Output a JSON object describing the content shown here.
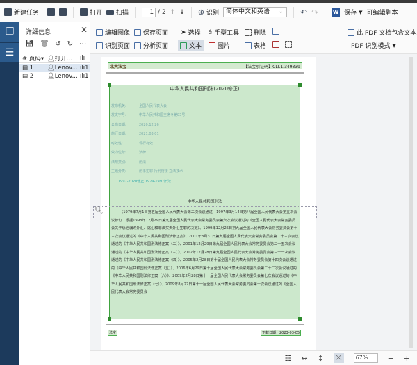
{
  "toolbar": {
    "new_task": "新建任务",
    "open": "打开",
    "scan": "扫描",
    "page_current": "1",
    "page_total": "/ 2",
    "recognize": "识别",
    "language": "简体中文和英语",
    "save": "保存",
    "editable_copy": "可编辑副本"
  },
  "nav": {
    "items": [
      "pages-icon",
      "list-icon"
    ]
  },
  "panel": {
    "title": "详细信息",
    "columns": [
      "#",
      "页码",
      "打开...",
      "ılı"
    ],
    "rows": [
      {
        "page": "1",
        "user": "Lenov...",
        "count": "1"
      },
      {
        "page": "2",
        "user": "Lenov...",
        "count": "1"
      }
    ]
  },
  "ribbon": {
    "edit_image": "编辑图像",
    "save_page": "保存页面",
    "recognize_page": "识别页面",
    "analyze_page": "分析页面",
    "select": "选择",
    "hand_tool": "手型工具",
    "delete": "删除",
    "text": "文本",
    "picture": "图片",
    "table": "表格",
    "text_layer": "此 PDF 文档包含文本层",
    "pdf_mode": "PDF 识别模式"
  },
  "document": {
    "header_logo": "北大法宝",
    "header_ref": "【法宝引证码】CLI.1.349339",
    "title": "中华人民共和国刑法(2020修正)",
    "meta": [
      [
        "发布机关:",
        "全国人民代表大会"
      ],
      [
        "发文字号:",
        "中华人民共和国主席令第83号"
      ],
      [
        "公布日期:",
        "2020.12.26"
      ],
      [
        "施行日期:",
        "2021.03.01"
      ],
      [
        "时效性:",
        "现行有效"
      ],
      [
        "效力位阶:",
        "法律"
      ],
      [
        "法规类别:",
        "刑法"
      ],
      [
        "主题分类:",
        "刑事犯罪    行刑衔接    立法技术"
      ]
    ],
    "versions": "1997-2020修正    1979-1997旧法",
    "subtitle": "中华人民共和国刑法",
    "body": "（1979年7月1日第五届全国人民代表大会第二次会议通过　1997年3月14日第八届全国人民代表大会第五次会议修订　根据1998年12月29日第九届全国人民代表大会常务委员会第六次会议通过的《全国人民代表大会常务委员会关于惩治骗购外汇、逃汇和非法买卖外汇犯罪的决定》、1999年12月25日第九届全国人民代表大会常务委员会第十三次会议通过的《中华人民共和国刑法修正案》、2001年8月31日第九届全国人民代表大会常务委员会第二十三次会议通过的《中华人民共和国刑法修正案（二）》、2001年12月29日第九届全国人民代表大会常务委员会第二十五次会议通过的《中华人民共和国刑法修正案（三）》、2002年12月28日第九届全国人民代表大会常务委员会第三十一次会议通过的《中华人民共和国刑法修正案（四）》、2005年2月28日第十届全国人民代表大会常务委员会第十四次会议通过的《中华人民共和国刑法修正案（五）》、2006年6月29日第十届全国人民代表大会常务委员会第二十二次会议通过的《中华人民共和国刑法修正案（六）》、2009年2月28日第十一届全国人民代表大会常务委员会第七次会议通过的《中华人民共和国刑法修正案（七）》、2009年8月27日第十一届全国人民代表大会常务委员会第十次会议通过的《全国人民代表大会常务委员会",
    "footer_left": "法宝",
    "footer_right": "下载日期：2023-03-05"
  },
  "status": {
    "zoom": "67%"
  }
}
